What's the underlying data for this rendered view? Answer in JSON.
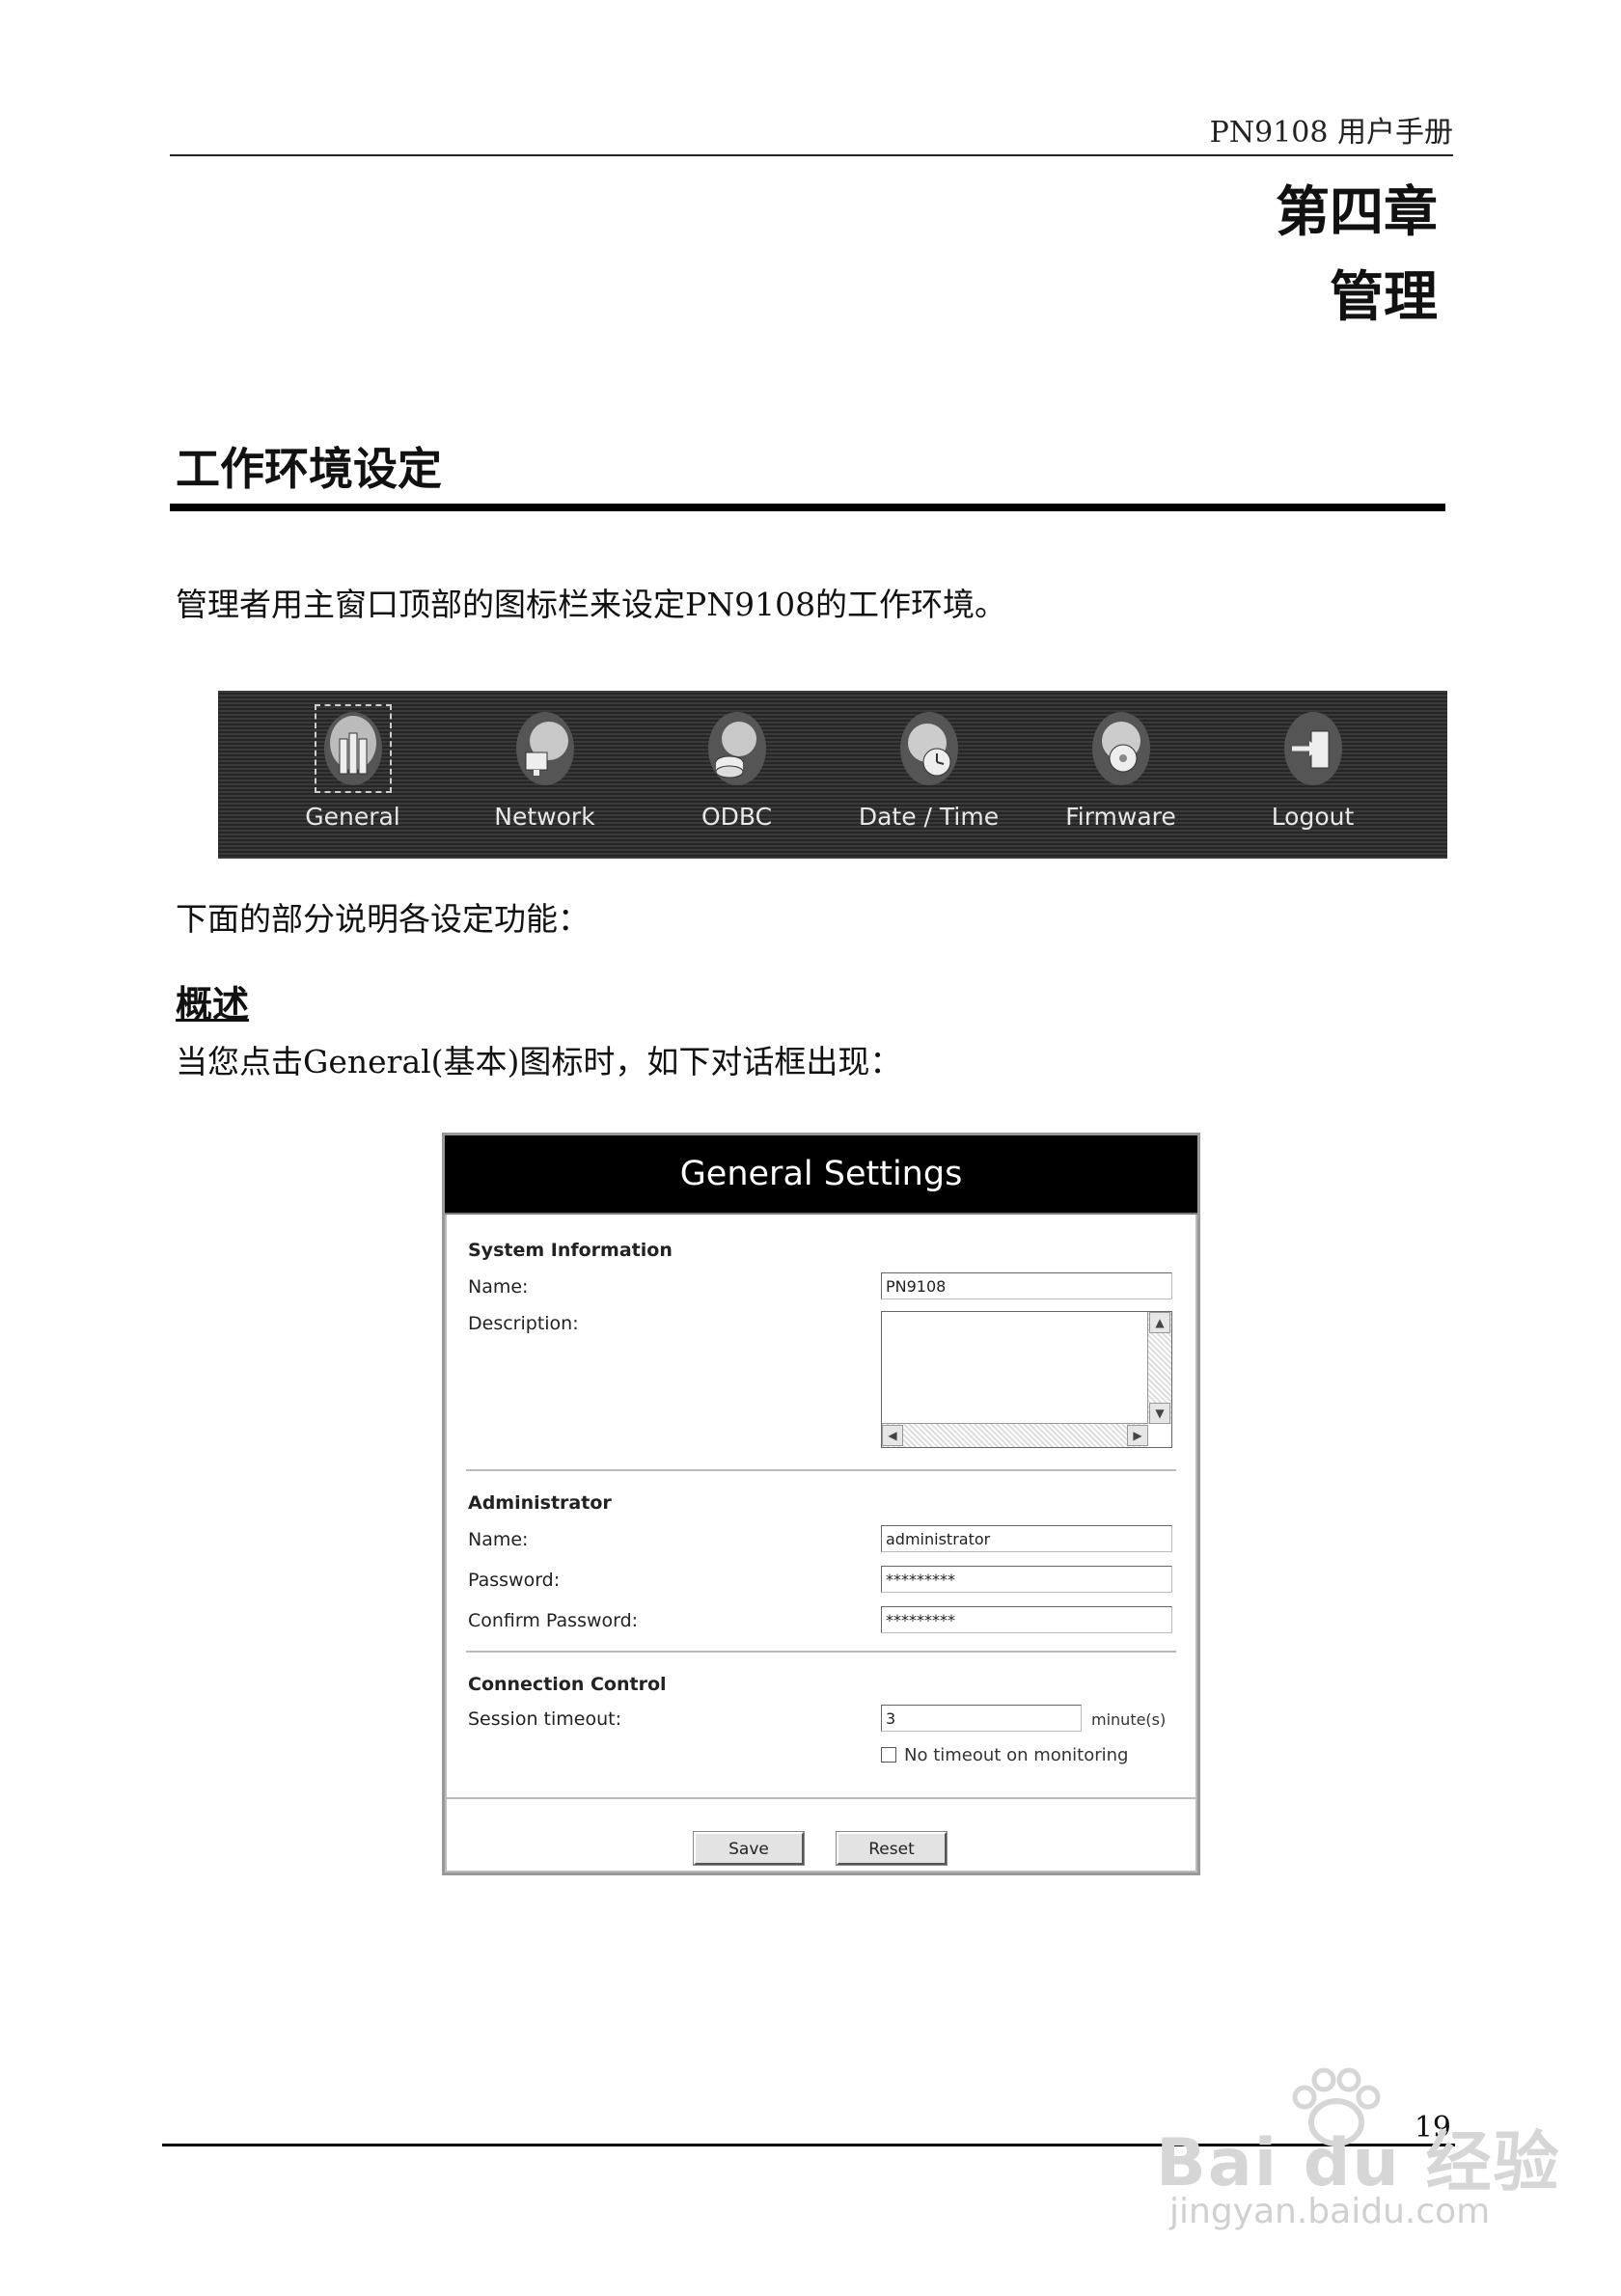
{
  "header": {
    "running_title": "PN9108  用户手册"
  },
  "chapter": {
    "number": "第四章",
    "title": "管理"
  },
  "section": {
    "title": "工作环境设定"
  },
  "paragraphs": {
    "intro": "管理者用主窗口顶部的图标栏来设定PN9108的工作环境。",
    "following": "下面的部分说明各设定功能：",
    "general_intro": "当您点击General(基本)图标时，如下对话框出现："
  },
  "subsection": {
    "title": "概述"
  },
  "toolbar": {
    "items": [
      {
        "label": "General",
        "icon": "general-icon",
        "selected": true
      },
      {
        "label": "Network",
        "icon": "network-icon"
      },
      {
        "label": "ODBC",
        "icon": "odbc-icon"
      },
      {
        "label": "Date / Time",
        "icon": "clock-icon"
      },
      {
        "label": "Firmware",
        "icon": "firmware-icon"
      },
      {
        "label": "Logout",
        "icon": "logout-icon"
      }
    ]
  },
  "dialog": {
    "title": "General Settings",
    "system_info": {
      "heading": "System Information",
      "name_label": "Name:",
      "name_value": "PN9108",
      "description_label": "Description:",
      "description_value": ""
    },
    "administrator": {
      "heading": "Administrator",
      "name_label": "Name:",
      "name_value": "administrator",
      "password_label": "Password:",
      "password_value": "*********",
      "confirm_label": "Confirm Password:",
      "confirm_value": "*********"
    },
    "connection": {
      "heading": "Connection Control",
      "timeout_label": "Session timeout:",
      "timeout_value": "3",
      "timeout_unit": "minute(s)",
      "no_timeout_label": "No timeout on monitoring",
      "no_timeout_checked": false
    },
    "buttons": {
      "save": "Save",
      "reset": "Reset"
    }
  },
  "footer": {
    "page_number": "19"
  },
  "watermark": {
    "line1": "Bai du 经验",
    "line2": "jingyan.baidu.com"
  }
}
